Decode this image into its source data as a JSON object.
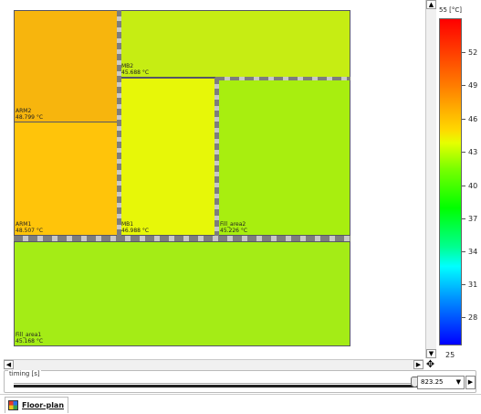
{
  "floorplan": {
    "blocks": [
      {
        "name": "ARM2",
        "temp": "48.799 °C",
        "color": "#f7b50d"
      },
      {
        "name": "ARM1",
        "temp": "48.507 °C",
        "color": "#ffc40a"
      },
      {
        "name": "MB2",
        "temp": "45.688 °C",
        "color": "#c6ed13"
      },
      {
        "name": "MB1",
        "temp": "46.988 °C",
        "color": "#e7f708"
      },
      {
        "name": "Fill_area2",
        "temp": "45.226 °C",
        "color": "#a8ee0f"
      },
      {
        "name": "Fill_area1",
        "temp": "45.168 °C",
        "color": "#a4ec16"
      }
    ]
  },
  "legend": {
    "unit_label": "55 [°C]",
    "ticks": [
      "52",
      "49",
      "46",
      "43",
      "40",
      "37",
      "34",
      "31",
      "28"
    ],
    "min_label": "25"
  },
  "timing": {
    "label": "timing [s]",
    "value": "823.25",
    "position_fraction": 1.0
  },
  "tabs": [
    {
      "label": "Floor-plan",
      "active": true
    }
  ],
  "icons": {
    "scroll_up": "▲",
    "scroll_down": "▼",
    "scroll_left": "◀",
    "scroll_right": "▶",
    "move": "✥",
    "dropdown": "▼",
    "next": "▶"
  }
}
